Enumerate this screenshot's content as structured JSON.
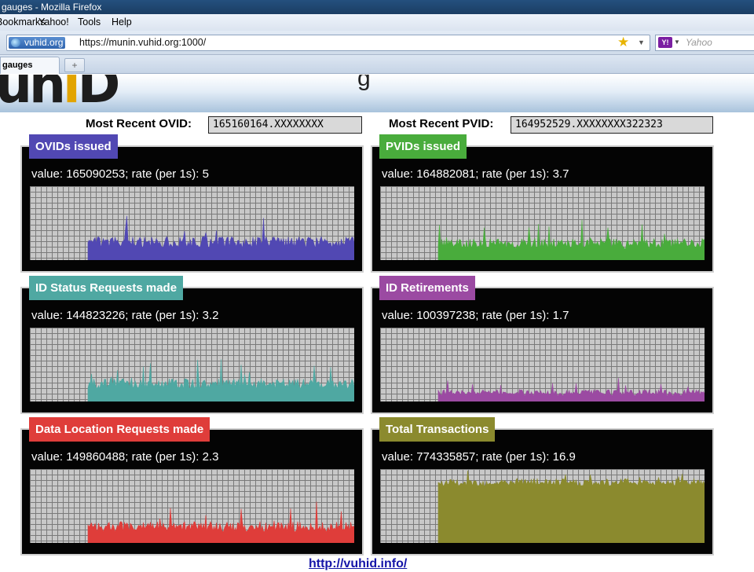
{
  "browser": {
    "window_title": "gauges - Mozilla Firefox",
    "menu": [
      "Bookmarks",
      "Yahoo!",
      "Tools",
      "Help"
    ],
    "site_identity": "vuhid.org",
    "url": "https://munin.vuhid.org:1000/",
    "search_placeholder": "Yahoo",
    "search_engine_logo": "Y!",
    "tab_title": "gauges",
    "new_tab_symbol": "+"
  },
  "header": {
    "logo_text_left": "uh",
    "logo_text_accent": "i",
    "logo_text_right": "D",
    "partial_title_glyph": "g"
  },
  "recent": {
    "ovid_label": "Most Recent OVID:",
    "ovid_value": "165160164.XXXXXXXX",
    "pvid_label": "Most Recent PVID:",
    "pvid_value": "164952529.XXXXXXXX322323"
  },
  "gauges": [
    {
      "title": "OVIDs issued",
      "value_text": "value: 165090253; rate (per 1s): 5",
      "color": "#5148b3",
      "start_fraction": 0.18,
      "base_level": 0.24,
      "variation": 0.16
    },
    {
      "title": "PVIDs issued",
      "value_text": "value: 164882081; rate (per 1s): 3.7",
      "color": "#49ac3c",
      "start_fraction": 0.18,
      "base_level": 0.22,
      "variation": 0.14
    },
    {
      "title": "ID Status Requests made",
      "value_text": "value: 144823226; rate (per 1s): 3.2",
      "color": "#4fa8a2",
      "start_fraction": 0.18,
      "base_level": 0.24,
      "variation": 0.14
    },
    {
      "title": "ID Retirements",
      "value_text": "value: 100397238; rate (per 1s): 1.7",
      "color": "#9b4aa2",
      "start_fraction": 0.18,
      "base_level": 0.12,
      "variation": 0.08
    },
    {
      "title": "Data Location Requests made",
      "value_text": "value: 149860488; rate (per 1s): 2.3",
      "color": "#df3d3a",
      "start_fraction": 0.18,
      "base_level": 0.22,
      "variation": 0.14
    },
    {
      "title": "Total Transactions",
      "value_text": "value: 774335857; rate (per 1s): 16.9",
      "color": "#8b8a2e",
      "start_fraction": 0.18,
      "base_level": 0.82,
      "variation": 0.1
    }
  ],
  "footer": {
    "link_text": "http://vuhid.info/"
  }
}
